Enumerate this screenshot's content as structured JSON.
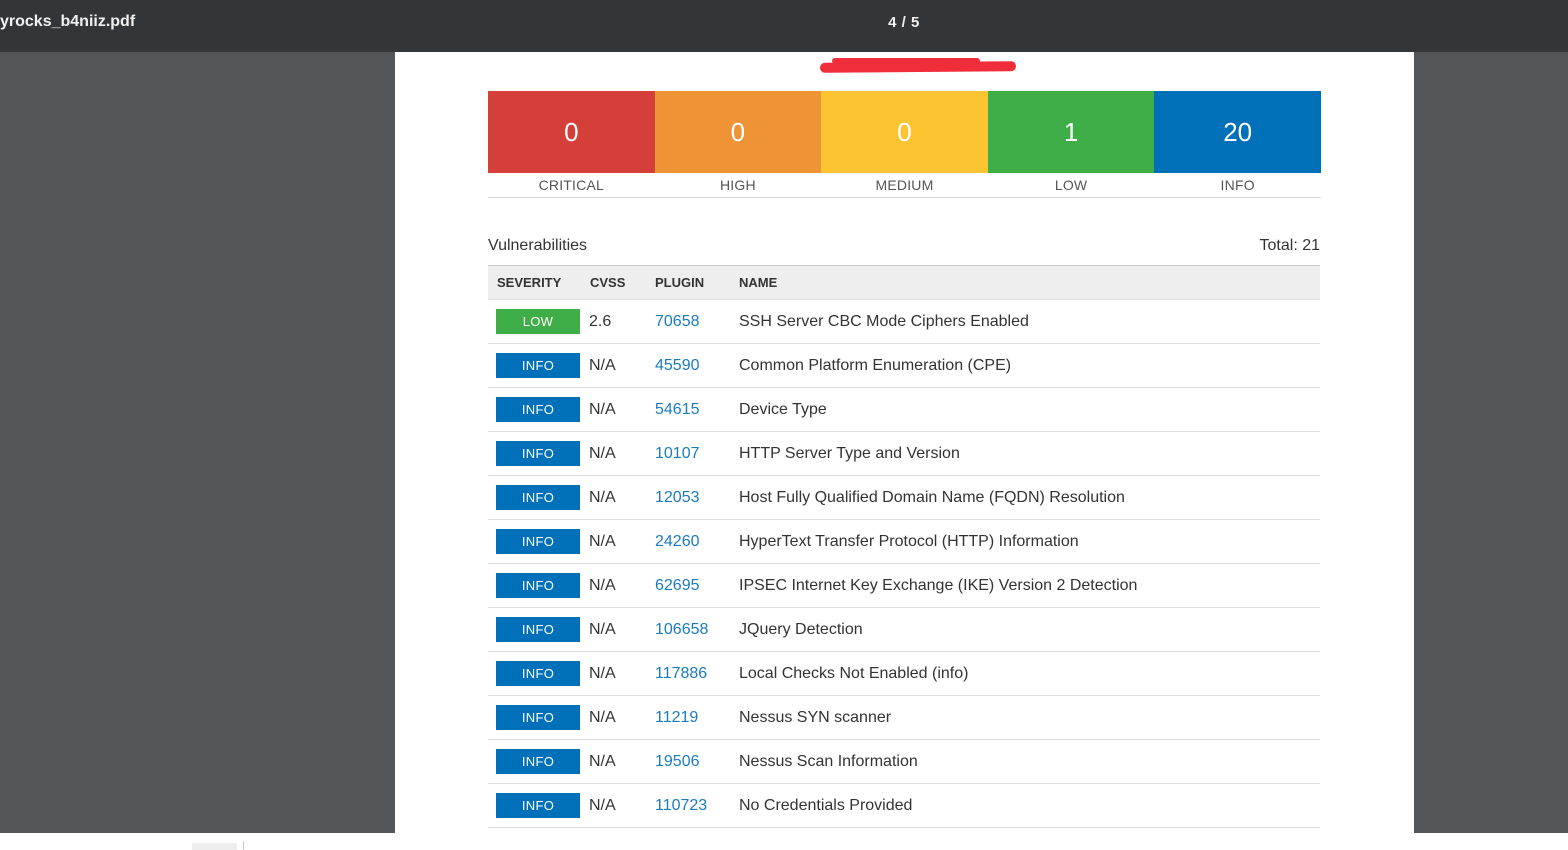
{
  "toolbar": {
    "file_name": "yrocks_b4niiz.pdf",
    "page_indicator": "4 / 5"
  },
  "colors": {
    "critical": "#d43f3a",
    "high": "#ee9336",
    "medium": "#fdc431",
    "low": "#3fae49",
    "info": "#0071b9",
    "plugin_link": "#1a7bbd",
    "redaction": "#ef2d3b"
  },
  "summary": [
    {
      "count": "0",
      "label": "CRITICAL",
      "color": "#d43f3a"
    },
    {
      "count": "0",
      "label": "HIGH",
      "color": "#ee9336"
    },
    {
      "count": "0",
      "label": "MEDIUM",
      "color": "#fdc431"
    },
    {
      "count": "1",
      "label": "LOW",
      "color": "#3fae49"
    },
    {
      "count": "20",
      "label": "INFO",
      "color": "#0071b9"
    }
  ],
  "vulnerabilities": {
    "title": "Vulnerabilities",
    "total": "Total: 21",
    "headers": {
      "severity": "SEVERITY",
      "cvss": "CVSS",
      "plugin": "PLUGIN",
      "name": "NAME"
    },
    "rows": [
      {
        "severity": "LOW",
        "color": "#3fae49",
        "cvss": "2.6",
        "plugin": "70658",
        "name": "SSH Server CBC Mode Ciphers Enabled"
      },
      {
        "severity": "INFO",
        "color": "#0071b9",
        "cvss": "N/A",
        "plugin": "45590",
        "name": "Common Platform Enumeration (CPE)"
      },
      {
        "severity": "INFO",
        "color": "#0071b9",
        "cvss": "N/A",
        "plugin": "54615",
        "name": "Device Type"
      },
      {
        "severity": "INFO",
        "color": "#0071b9",
        "cvss": "N/A",
        "plugin": "10107",
        "name": "HTTP Server Type and Version"
      },
      {
        "severity": "INFO",
        "color": "#0071b9",
        "cvss": "N/A",
        "plugin": "12053",
        "name": "Host Fully Qualified Domain Name (FQDN) Resolution"
      },
      {
        "severity": "INFO",
        "color": "#0071b9",
        "cvss": "N/A",
        "plugin": "24260",
        "name": "HyperText Transfer Protocol (HTTP) Information"
      },
      {
        "severity": "INFO",
        "color": "#0071b9",
        "cvss": "N/A",
        "plugin": "62695",
        "name": "IPSEC Internet Key Exchange (IKE) Version 2 Detection"
      },
      {
        "severity": "INFO",
        "color": "#0071b9",
        "cvss": "N/A",
        "plugin": "106658",
        "name": "JQuery Detection"
      },
      {
        "severity": "INFO",
        "color": "#0071b9",
        "cvss": "N/A",
        "plugin": "117886",
        "name": "Local Checks Not Enabled (info)"
      },
      {
        "severity": "INFO",
        "color": "#0071b9",
        "cvss": "N/A",
        "plugin": "11219",
        "name": "Nessus SYN scanner"
      },
      {
        "severity": "INFO",
        "color": "#0071b9",
        "cvss": "N/A",
        "plugin": "19506",
        "name": "Nessus Scan Information"
      },
      {
        "severity": "INFO",
        "color": "#0071b9",
        "cvss": "N/A",
        "plugin": "110723",
        "name": "No Credentials Provided"
      }
    ]
  }
}
